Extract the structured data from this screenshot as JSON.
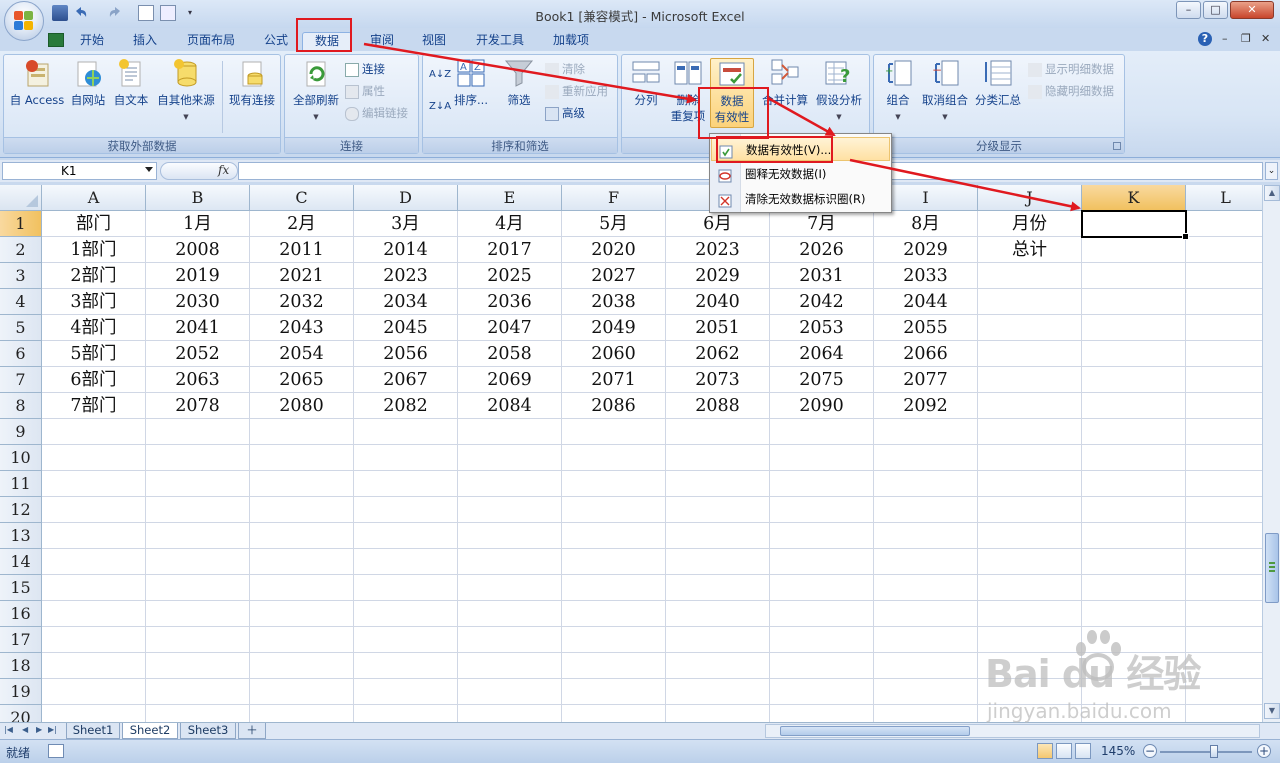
{
  "title_bar": {
    "title": "Book1  [兼容模式] - Microsoft Excel",
    "minimize": "–",
    "maximize": "□",
    "close": "✕"
  },
  "ribbon_tabs": [
    "开始",
    "插入",
    "页面布局",
    "公式",
    "数据",
    "审阅",
    "视图",
    "开发工具",
    "加载项"
  ],
  "active_tab": "数据",
  "tab_right": {
    "help": "?",
    "min": "–",
    "restore": "❐",
    "close": "✕"
  },
  "groups": {
    "external": {
      "label": "获取外部数据",
      "buttons": [
        "自 Access",
        "自网站",
        "自文本",
        "自其他来源",
        "现有连接"
      ]
    },
    "connections": {
      "label": "连接",
      "refresh_all": "全部刷新",
      "connections": "连接",
      "properties": "属性",
      "edit_links": "编辑链接"
    },
    "sort_filter": {
      "label": "排序和筛选",
      "sort": "排序...",
      "filter": "筛选",
      "clear": "清除",
      "reapply": "重新应用",
      "advanced": "高级"
    },
    "data_tools": {
      "text_to_columns": "分列",
      "remove_dup_line1": "删除",
      "remove_dup_line2": "重复项",
      "validation_line1": "数据",
      "validation_line2": "有效性",
      "consolidate": "合并计算",
      "what_if": "假设分析"
    },
    "outline": {
      "label": "分级显示",
      "group": "组合",
      "ungroup": "取消组合",
      "subtotal": "分类汇总",
      "show_detail": "显示明细数据",
      "hide_detail": "隐藏明细数据"
    }
  },
  "validation_menu": [
    "数据有效性(V)...",
    "圈释无效数据(I)",
    "清除无效数据标识圈(R)"
  ],
  "formula_bar": {
    "name_box": "K1",
    "fx": "fx",
    "value": ""
  },
  "columns": [
    "A",
    "B",
    "C",
    "D",
    "E",
    "F",
    "G",
    "H",
    "I",
    "J",
    "K",
    "L"
  ],
  "rows": [
    "1",
    "2",
    "3",
    "4",
    "5",
    "6",
    "7",
    "8",
    "9",
    "10",
    "11",
    "12",
    "13",
    "14",
    "15",
    "16",
    "17",
    "18",
    "19",
    "20"
  ],
  "cells": [
    [
      "部门",
      "1月",
      "2月",
      "3月",
      "4月",
      "5月",
      "6月",
      "7月",
      "8月",
      "月份"
    ],
    [
      "1部门",
      "2008",
      "2011",
      "2014",
      "2017",
      "2020",
      "2023",
      "2026",
      "2029",
      "总计"
    ],
    [
      "2部门",
      "2019",
      "2021",
      "2023",
      "2025",
      "2027",
      "2029",
      "2031",
      "2033"
    ],
    [
      "3部门",
      "2030",
      "2032",
      "2034",
      "2036",
      "2038",
      "2040",
      "2042",
      "2044"
    ],
    [
      "4部门",
      "2041",
      "2043",
      "2045",
      "2047",
      "2049",
      "2051",
      "2053",
      "2055"
    ],
    [
      "5部门",
      "2052",
      "2054",
      "2056",
      "2058",
      "2060",
      "2062",
      "2064",
      "2066"
    ],
    [
      "6部门",
      "2063",
      "2065",
      "2067",
      "2069",
      "2071",
      "2073",
      "2075",
      "2077"
    ],
    [
      "7部门",
      "2078",
      "2080",
      "2082",
      "2084",
      "2086",
      "2088",
      "2090",
      "2092"
    ]
  ],
  "selected_cell": "K1",
  "sheets": [
    "Sheet1",
    "Sheet2",
    "Sheet3"
  ],
  "active_sheet": "Sheet2",
  "status": {
    "ready": "就绪",
    "zoom": "145%",
    "zoom_out": "−",
    "zoom_in": "+"
  },
  "watermark": {
    "logo": "Bai du 经验",
    "url": "jingyan.baidu.com"
  },
  "colors": {
    "annotation_red": "#e0191f",
    "selected_header": "#f1c15f",
    "ribbon_text": "#15428b"
  }
}
